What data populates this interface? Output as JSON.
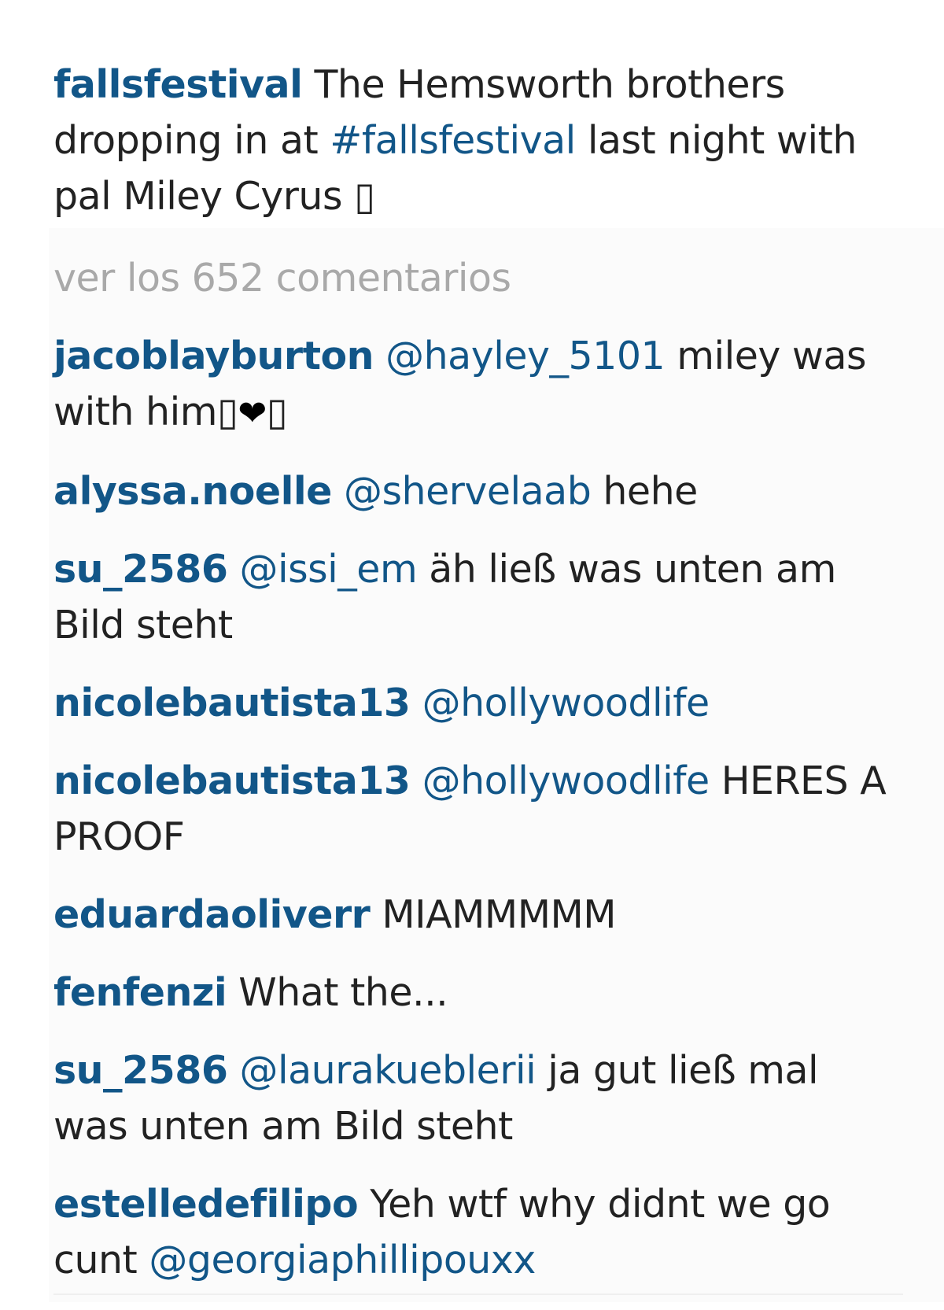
{
  "caption": {
    "username": "fallsfestival",
    "text_1": "The Hemsworth brothers dropping in at",
    "hashtag": "#fallsfestival",
    "text_2": "last night with pal Miley Cyrus",
    "emoji_placeholder": "▯"
  },
  "view_all_comments": "ver los 652 comentarios",
  "comments": [
    {
      "username": "jacoblayburton",
      "mention": "@hayley_5101",
      "text": "miley was with him",
      "emoji_1": "▯",
      "heart": "❤",
      "emoji_2": "▯"
    },
    {
      "username": "alyssa.noelle",
      "mention": "@shervelaab",
      "text": "hehe"
    },
    {
      "username": "su_2586",
      "mention": "@issi_em",
      "text": "äh ließ was unten am Bild steht"
    },
    {
      "username": "nicolebautista13",
      "mention": "@hollywoodlife",
      "text": ""
    },
    {
      "username": "nicolebautista13",
      "mention": "@hollywoodlife",
      "text": "HERES A PROOF"
    },
    {
      "username": "eduardaoliverr",
      "text": "MIAMMMMM"
    },
    {
      "username": "fenfenzi",
      "text": "What the..."
    },
    {
      "username": "su_2586",
      "mention": "@laurakueblerii",
      "text": "ja gut ließ mal was unten am Bild steht"
    },
    {
      "username": "estelledefilipo",
      "text": "Yeh wtf why didnt we go cunt",
      "mention": "@georgiaphillipouxx"
    }
  ],
  "colors": {
    "username": "#125688",
    "text": "#222222",
    "muted": "#a9a9a9"
  }
}
